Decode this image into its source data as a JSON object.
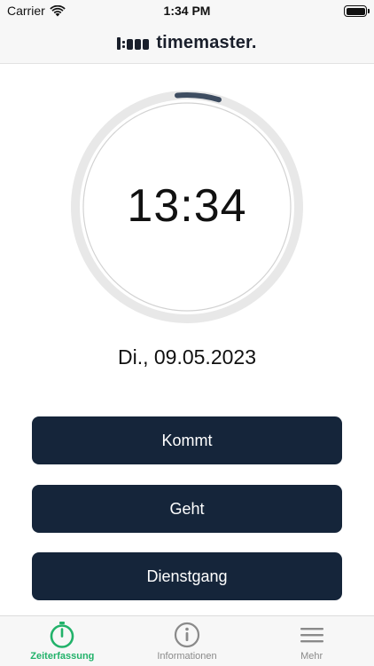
{
  "status_bar": {
    "carrier": "Carrier",
    "time": "1:34 PM"
  },
  "header": {
    "logo_text": "timemaster."
  },
  "clock": {
    "time": "13:34",
    "progress_fraction": 0.06
  },
  "date": "Di., 09.05.2023",
  "actions": [
    {
      "label": "Kommt"
    },
    {
      "label": "Geht"
    },
    {
      "label": "Dienstgang"
    }
  ],
  "tabs": [
    {
      "label": "Zeiterfassung",
      "icon": "stopwatch-icon",
      "active": true
    },
    {
      "label": "Informationen",
      "icon": "info-icon",
      "active": false
    },
    {
      "label": "Mehr",
      "icon": "menu-icon",
      "active": false
    }
  ],
  "colors": {
    "accent": "#22b26a",
    "button": "#15253a",
    "ring": "#e8e8e8",
    "progress": "#3d4c60"
  }
}
